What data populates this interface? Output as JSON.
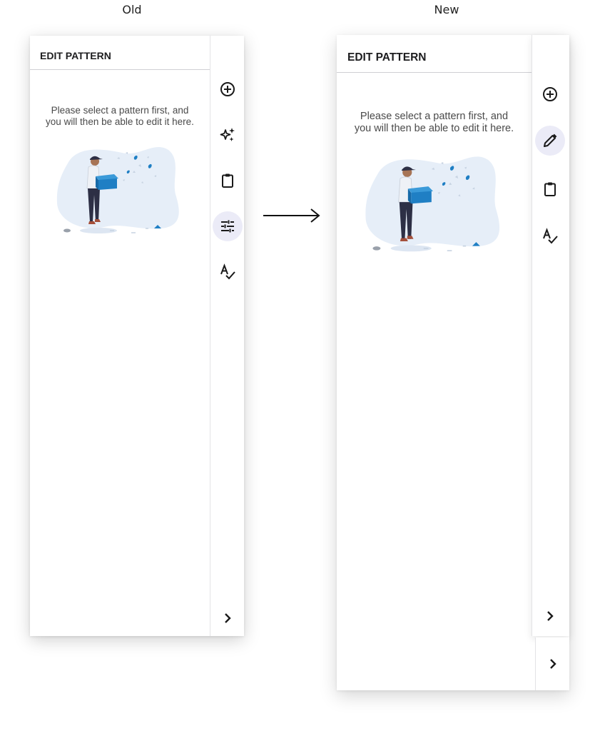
{
  "labels": {
    "old": "Old",
    "new": "New"
  },
  "old_panel": {
    "title": "EDIT PATTERN",
    "message_line1": "Please select a pattern first, and",
    "message_line2": "you will then be able to edit it here.",
    "rail_icons": [
      "add-circle-icon",
      "sparkle-icon",
      "clipboard-icon",
      "tune-sliders-icon",
      "spellcheck-icon",
      "chevron-right-icon"
    ],
    "active_icon": "tune-sliders-icon"
  },
  "new_panel": {
    "title": "EDIT PATTERN",
    "message_line1": "Please select a pattern first, and",
    "message_line2": "you will then be able to edit it here.",
    "rail_icons": [
      "add-circle-icon",
      "pencil-icon",
      "clipboard-icon",
      "spellcheck-icon",
      "chevron-right-icon"
    ],
    "active_icon": "pencil-icon",
    "extra_tab_icon": "chevron-right-icon"
  },
  "colors": {
    "active_bg": "#ebebf7",
    "illustration_blob": "#e6eef8",
    "box_blue": "#1f7fc4",
    "divider": "#cfcfd4"
  }
}
